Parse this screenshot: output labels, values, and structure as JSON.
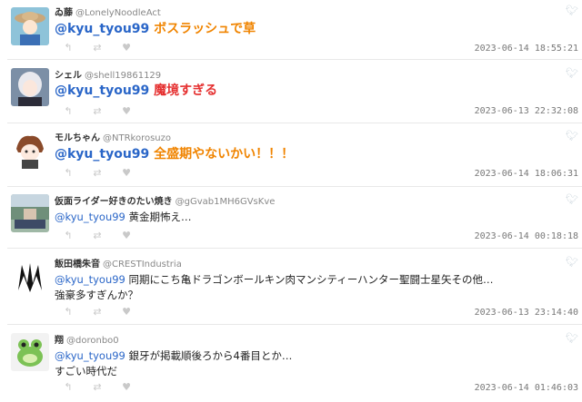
{
  "tweets": [
    {
      "display_name": "ゐ藤",
      "handle": "@LonelyNoodleAct",
      "mention": "@kyu_tyou99",
      "text": "ボスラッシュで草",
      "text_line2": "",
      "emphasis": "orange",
      "timestamp": "2023-06-14 18:55:21"
    },
    {
      "display_name": "シェル",
      "handle": "@shell19861129",
      "mention": "@kyu_tyou99",
      "text": "魔境すぎる",
      "text_line2": "",
      "emphasis": "red",
      "timestamp": "2023-06-13 22:32:08"
    },
    {
      "display_name": "モルちゃん",
      "handle": "@NTRkorosuzo",
      "mention": "@kyu_tyou99",
      "text": "全盛期やないかい！！！",
      "text_line2": "",
      "emphasis": "orange",
      "timestamp": "2023-06-14 18:06:31"
    },
    {
      "display_name": "仮面ライダー好きのたい焼き",
      "handle": "@gGvab1MH6GVsKve",
      "mention": "@kyu_tyou99",
      "text": "黄金期怖え…",
      "text_line2": "",
      "emphasis": "none",
      "timestamp": "2023-06-14 00:18:18"
    },
    {
      "display_name": "飯田橋朱音",
      "handle": "@CRESTIndustria",
      "mention": "@kyu_tyou99",
      "text": "同期にこち亀ドラゴンボールキン肉マンシティーハンター聖闘士星矢その他…",
      "text_line2": "強豪多すぎんか？",
      "emphasis": "none",
      "timestamp": "2023-06-13 23:14:40"
    },
    {
      "display_name": "翔",
      "handle": "@doronbo0",
      "mention": "@kyu_tyou99",
      "text": "銀牙が掲載順後ろから4番目とか…",
      "text_line2": "すごい時代だ",
      "emphasis": "none",
      "timestamp": "2023-06-14 01:46:03"
    }
  ],
  "icons": {
    "bird": "bird-icon",
    "reply": "reply-icon",
    "retweet": "retweet-icon",
    "like": "like-icon"
  },
  "colors": {
    "mention": "#2a66c8",
    "orange": "#f08400",
    "red": "#e53030"
  }
}
